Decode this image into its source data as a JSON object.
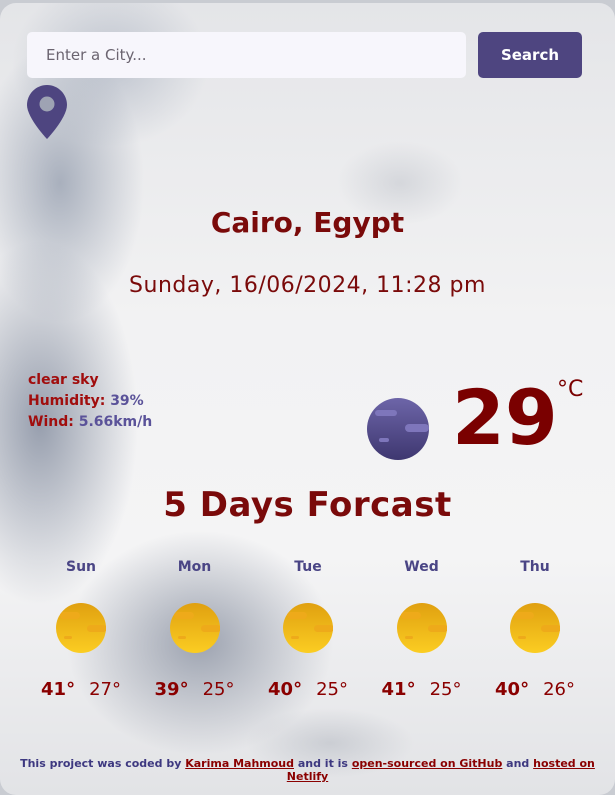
{
  "search": {
    "placeholder": "Enter a City...",
    "value": "",
    "button_label": "Search"
  },
  "location_icon": "map-pin-icon",
  "current": {
    "city": "Cairo, Egypt",
    "datetime": "Sunday, 16/06/2024, 11:28 pm",
    "description": "clear sky",
    "humidity_label": "Humidity:",
    "humidity_value": "39%",
    "wind_label": "Wind:",
    "wind_value": "5.66km/h",
    "icon": "clear-night-moon-icon",
    "temperature": "29",
    "unit": "°C"
  },
  "forecast": {
    "title": "5 Days Forcast",
    "days": [
      {
        "day": "Sun",
        "icon": "sun-icon",
        "max": "41°",
        "min": "27°"
      },
      {
        "day": "Mon",
        "icon": "sun-icon",
        "max": "39°",
        "min": "25°"
      },
      {
        "day": "Tue",
        "icon": "sun-icon",
        "max": "40°",
        "min": "25°"
      },
      {
        "day": "Wed",
        "icon": "sun-icon",
        "max": "41°",
        "min": "25°"
      },
      {
        "day": "Thu",
        "icon": "sun-icon",
        "max": "40°",
        "min": "26°"
      }
    ]
  },
  "footer": {
    "text1": "This project was coded by ",
    "author_link": "Karima Mahmoud",
    "text2": " and it is ",
    "github_link": "open-sourced on GitHub",
    "text3": " and ",
    "netlify_link": "hosted on Netlify"
  },
  "colors": {
    "accent": "#4e4580",
    "primary_text": "#7a0a0a",
    "sun": "#f5b81a"
  }
}
